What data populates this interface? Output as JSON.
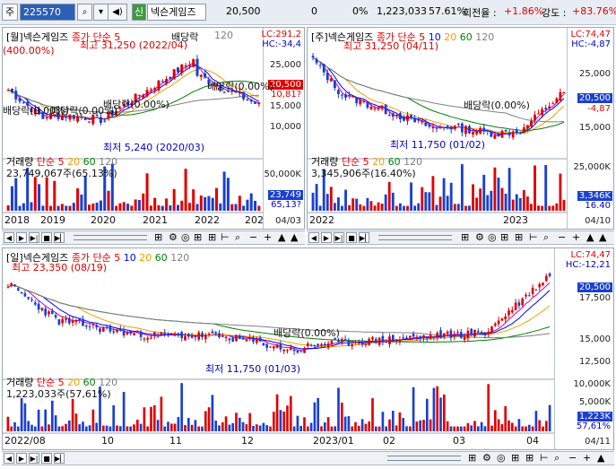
{
  "toolbar": {
    "market": "주",
    "code": "225570",
    "badge": "신",
    "name": "넥슨게임즈",
    "price": "20,500",
    "change": "0",
    "change_pct": "0%",
    "volume": "1,223,033",
    "volume_pct": "57.61%",
    "turnover_label": "회전율 :",
    "turnover": "+1.86%",
    "strength_label": "강도 :",
    "strength": "+83.76%"
  },
  "panel_monthly": {
    "title": "[월]넥슨게임즈",
    "ma_label": "종가 단순 5",
    "ma_periods": [
      "10",
      "20",
      "60",
      "120"
    ],
    "lc": "LC:291,2",
    "hc": "HC:-34,4",
    "high_note": "최고 31,250 (2022/04)",
    "low_note": "최저 5,240 (2020/03)",
    "split_note": "(400.00%)",
    "div1": "배당락(0.00%)",
    "div2": "배당락(0.00%)",
    "div3": "배당락(0.00%)",
    "div4": "배당락(0.00%)",
    "div5": "배당락",
    "price_box": "20,500",
    "price_box2": "10,81?",
    "y_ticks": [
      "25,000",
      "20,000",
      "15,000",
      "10,000"
    ],
    "vol_title": "거래량",
    "vol_ma": "단순 5",
    "vol_periods": [
      "20",
      "60",
      "120"
    ],
    "vol_value": "23,749,067주(65.13%)",
    "vol_ticks": [
      "50,000K",
      "25,000K"
    ],
    "vol_box": "23,749",
    "vol_box2": "65,13?",
    "x_ticks": [
      "2018",
      "2019",
      "2020",
      "2021",
      "2022",
      "202"
    ],
    "x_last": "04/03"
  },
  "panel_weekly": {
    "title": "[주]넥슨게임즈",
    "ma_label": "종가 단순 5",
    "ma_periods": [
      "10",
      "20",
      "60",
      "120"
    ],
    "lc": "LC:74,47",
    "hc": "HC:-4,87",
    "high_note": "최고 31,250 (04/11)",
    "low_note": "최저 11,750 (01/02)",
    "div1": "배당락(0.00%)",
    "price_box": "20,500",
    "price_box2": "-4,87",
    "y_ticks": [
      "25,000",
      "20,000",
      "15,000"
    ],
    "vol_title": "거래량",
    "vol_ma": "단순 5",
    "vol_periods": [
      "20",
      "60",
      "120"
    ],
    "vol_value": "3,345,906주(16.40%)",
    "vol_ticks": [
      "25,000K"
    ],
    "vol_box": "3,346K",
    "vol_box2": "16.40",
    "x_ticks": [
      "2022",
      "2023"
    ],
    "x_last": "04/10"
  },
  "panel_daily": {
    "title": "[일]넥슨게임즈",
    "ma_label": "종가 단순 5",
    "ma_periods": [
      "10",
      "20",
      "60",
      "120"
    ],
    "lc": "LC:74,47",
    "hc": "HC:-12,21",
    "high_note": "최고 23,350 (08/19)",
    "low_note": "최저 11,750 (01/03)",
    "div1": "배당락(0.00%)",
    "price_box": "20,500",
    "y_ticks": [
      "17,500",
      "15,000",
      "12,500"
    ],
    "vol_title": "거래량",
    "vol_ma": "단순 5",
    "vol_periods": [
      "20",
      "60",
      "120"
    ],
    "vol_value": "1,223,033주(57,61%)",
    "vol_ticks": [
      "10,000K",
      "5,000K"
    ],
    "vol_box": "1,223K",
    "vol_box2": "57,61%",
    "x_ticks": [
      "2022/08",
      "10",
      "11",
      "12",
      "2023/01",
      "02",
      "03",
      "04"
    ],
    "x_last": "04/11"
  },
  "colors": {
    "up": "#e00000",
    "down": "#1a3fd0",
    "ma5": "#c000c0",
    "ma10": "#0000ff",
    "ma20": "#f0a000",
    "ma60": "#008000",
    "ma120": "#808080"
  },
  "nav_icons": [
    "prev-icon",
    "play-icon",
    "next-icon",
    "stop-icon",
    "end-icon",
    "slider-icon",
    "grid-icon",
    "settings-icon",
    "zoom-icon",
    "plus-icon",
    "minus-icon"
  ]
}
